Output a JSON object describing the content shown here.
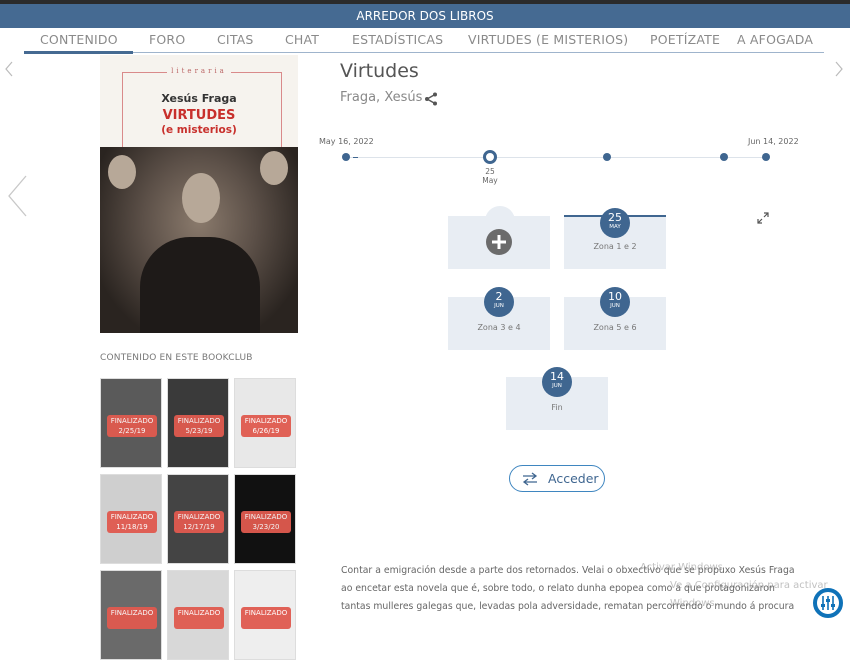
{
  "app": {
    "title": "ARREDOR DOS LIBROS"
  },
  "tabs": [
    {
      "label": "CONTENIDO",
      "active": true
    },
    {
      "label": "FORO"
    },
    {
      "label": "CITAS"
    },
    {
      "label": "CHAT"
    },
    {
      "label": "ESTADÍSTICAS"
    },
    {
      "label": "VIRTUDES (E MISTERIOS)"
    },
    {
      "label": "POETÍZATE"
    },
    {
      "label": "A AFOGADA"
    }
  ],
  "cover": {
    "series": "literaria",
    "author": "Xesús Fraga",
    "title": "VIRTUDES",
    "subtitle": "(e misterios)"
  },
  "book": {
    "title": "Virtudes",
    "author": "Fraga, Xesús"
  },
  "timeline": {
    "start": "May 16, 2022",
    "end": "Jun 14, 2022",
    "current": {
      "day": "25",
      "month": "May"
    }
  },
  "cards": [
    {
      "day": "25",
      "month": "MAY",
      "label": "Zona 1 e 2"
    },
    {
      "day": "2",
      "month": "JUN",
      "label": "Zona 3 e 4"
    },
    {
      "day": "10",
      "month": "JUN",
      "label": "Zona 5 e 6"
    },
    {
      "day": "14",
      "month": "JUN",
      "label": "Fin"
    }
  ],
  "access_button": {
    "label": "Acceder"
  },
  "bookclub": {
    "section_label": "CONTENIDO EN ESTE BOOKCLUB",
    "items": [
      {
        "status": "FINALIZADO",
        "date": "2/25/19",
        "bg": "#5a5a5a"
      },
      {
        "status": "FINALIZADO",
        "date": "5/23/19",
        "bg": "#3a3a3a"
      },
      {
        "status": "FINALIZADO",
        "date": "6/26/19",
        "bg": "#e8e8e8"
      },
      {
        "status": "FINALIZADO",
        "date": "11/18/19",
        "bg": "#cfcfcf"
      },
      {
        "status": "FINALIZADO",
        "date": "12/17/19",
        "bg": "#444444"
      },
      {
        "status": "FINALIZADO",
        "date": "3/23/20",
        "bg": "#111111"
      },
      {
        "status": "FINALIZADO",
        "date": "",
        "bg": "#6a6a6a"
      },
      {
        "status": "FINALIZADO",
        "date": "",
        "bg": "#d8d8d8"
      },
      {
        "status": "FINALIZADO",
        "date": "",
        "bg": "#eeeeee"
      }
    ]
  },
  "description": "Contar a emigración desde a parte dos retornados. Velai o obxectivo que se propuxo Xesús Fraga ao encetar esta novela que é, sobre todo, o relato dunha epopea como a que protagonizaron tantas mulleres galegas que, levadas pola adversidade, rematan percorrendo o mundo á procura",
  "watermark": {
    "line1": "Activar Windows",
    "line2": "Ve a Configuración para activar Windows."
  },
  "colors": {
    "brand": "#456a92",
    "accent": "#3f6690",
    "badge": "#e05a4f",
    "fab": "#0f72b8"
  }
}
